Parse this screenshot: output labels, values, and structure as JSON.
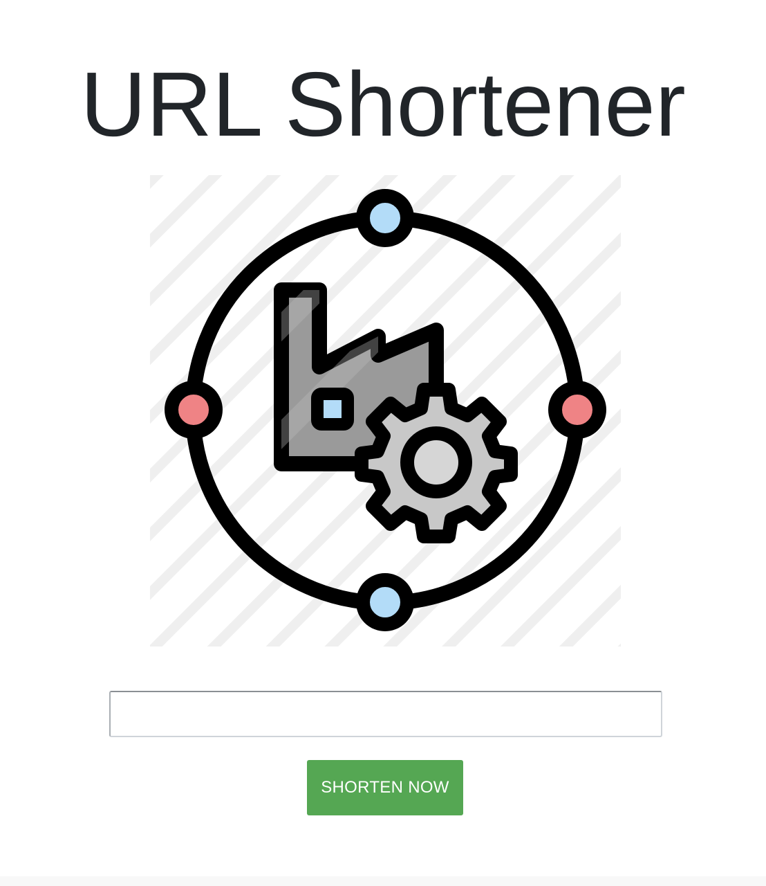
{
  "header": {
    "title": "URL Shortener"
  },
  "illustration": {
    "icon": "factory-gear-network-icon",
    "colors": {
      "outline": "#000000",
      "node_blue": "#b3dcf8",
      "node_red": "#ef8385",
      "factory_fill": "#999999",
      "gear_fill": "#c8c8c8",
      "gear_hub": "#d6d6d6",
      "stripes": "#eeeeee"
    }
  },
  "form": {
    "url_input": {
      "value": "",
      "placeholder": ""
    },
    "submit_label": "SHORTEN NOW"
  },
  "theme": {
    "button_color": "#55a753",
    "title_color": "#212529"
  }
}
